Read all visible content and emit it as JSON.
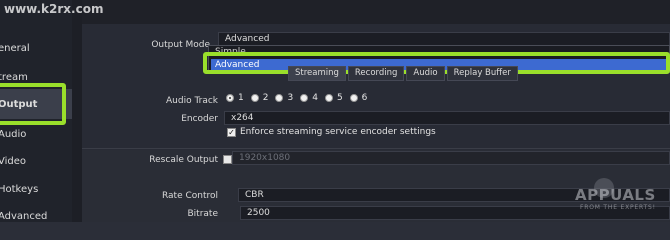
{
  "watermark": "www.k2rx.com",
  "sidebar": {
    "items": [
      {
        "label": "eneral"
      },
      {
        "label": "tream"
      },
      {
        "label": "Output"
      },
      {
        "label": "Audio"
      },
      {
        "label": "Video"
      },
      {
        "label": "Hotkeys"
      },
      {
        "label": "Advanced"
      }
    ]
  },
  "output_mode": {
    "label": "Output Mode",
    "value": "Advanced",
    "options": [
      "Simple",
      "Advanced"
    ]
  },
  "tabs": [
    "Streaming",
    "Recording",
    "Audio",
    "Replay Buffer"
  ],
  "audio_track": {
    "label": "Audio Track",
    "options": [
      "1",
      "2",
      "3",
      "4",
      "5",
      "6"
    ],
    "selected": "1"
  },
  "encoder": {
    "label": "Encoder",
    "value": "x264"
  },
  "enforce": {
    "label": "Enforce streaming service encoder settings",
    "checked": true
  },
  "rescale": {
    "label": "Rescale Output",
    "value": "1920x1080",
    "checked": false
  },
  "rate_control": {
    "label": "Rate Control",
    "value": "CBR"
  },
  "bitrate": {
    "label": "Bitrate",
    "value": "2500"
  },
  "brand": {
    "name": "APPUALS",
    "tagline": "FROM THE EXPERTS!"
  },
  "colors": {
    "highlight": "#9adf2b",
    "selection": "#3d6ad1"
  }
}
